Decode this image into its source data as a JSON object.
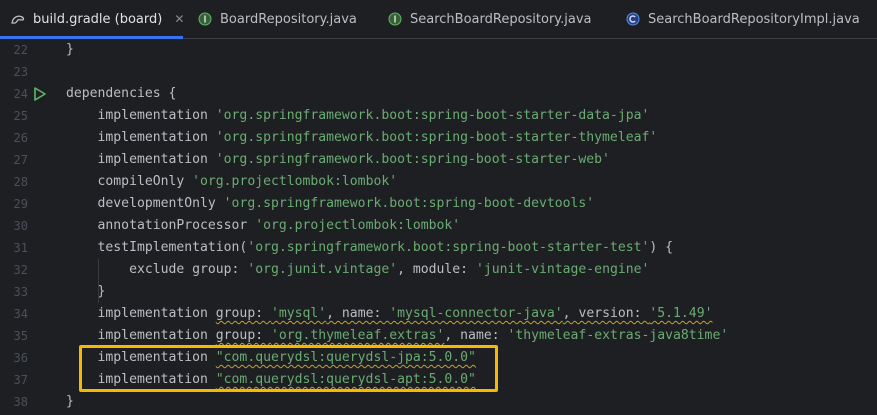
{
  "tabs": [
    {
      "label": "build.gradle (board)",
      "icon": "gradle-icon",
      "active": true
    },
    {
      "label": "BoardRepository.java",
      "icon": "interface-icon",
      "active": false
    },
    {
      "label": "SearchBoardRepository.java",
      "icon": "interface-icon",
      "active": false
    },
    {
      "label": "SearchBoardRepositoryImpl.java",
      "icon": "class-icon",
      "active": false
    }
  ],
  "colors": {
    "background": "#1e1f22",
    "text": "#bcbec4",
    "string": "#6aab73",
    "line_number": "#4b5059",
    "active_tab_underline": "#3574f0",
    "highlight_box": "#f7b800",
    "run_icon": "#5fb865"
  },
  "lines": [
    {
      "num": "22",
      "parts": [
        {
          "t": "}",
          "c": "plain"
        }
      ]
    },
    {
      "num": "23",
      "parts": []
    },
    {
      "num": "24",
      "parts": [
        {
          "t": "dependencies {",
          "c": "plain"
        }
      ]
    },
    {
      "num": "25",
      "parts": [
        {
          "t": "    implementation ",
          "c": "plain"
        },
        {
          "t": "'org.springframework.boot:spring-boot-starter-data-jpa'",
          "c": "str"
        }
      ]
    },
    {
      "num": "26",
      "parts": [
        {
          "t": "    implementation ",
          "c": "plain"
        },
        {
          "t": "'org.springframework.boot:spring-boot-starter-thymeleaf'",
          "c": "str"
        }
      ]
    },
    {
      "num": "27",
      "parts": [
        {
          "t": "    implementation ",
          "c": "plain"
        },
        {
          "t": "'org.springframework.boot:spring-boot-starter-web'",
          "c": "str"
        }
      ]
    },
    {
      "num": "28",
      "parts": [
        {
          "t": "    compileOnly ",
          "c": "plain"
        },
        {
          "t": "'org.projectlombok:lombok'",
          "c": "str"
        }
      ]
    },
    {
      "num": "29",
      "parts": [
        {
          "t": "    developmentOnly ",
          "c": "plain"
        },
        {
          "t": "'org.springframework.boot:spring-boot-devtools'",
          "c": "str"
        }
      ]
    },
    {
      "num": "30",
      "parts": [
        {
          "t": "    annotationProcessor ",
          "c": "plain"
        },
        {
          "t": "'org.projectlombok:lombok'",
          "c": "str"
        }
      ]
    },
    {
      "num": "31",
      "parts": [
        {
          "t": "    testImplementation(",
          "c": "plain"
        },
        {
          "t": "'org.springframework.boot:spring-boot-starter-test'",
          "c": "str"
        },
        {
          "t": ") {",
          "c": "plain"
        }
      ]
    },
    {
      "num": "32",
      "parts": [
        {
          "t": "        exclude group: ",
          "c": "plain"
        },
        {
          "t": "'org.junit.vintage'",
          "c": "str"
        },
        {
          "t": ", module: ",
          "c": "plain"
        },
        {
          "t": "'junit-vintage-engine'",
          "c": "str"
        }
      ]
    },
    {
      "num": "33",
      "parts": [
        {
          "t": "    }",
          "c": "plain"
        }
      ]
    },
    {
      "num": "34",
      "parts": [
        {
          "t": "    implementation ",
          "c": "plain"
        },
        {
          "t": "group: ",
          "c": "plain warn"
        },
        {
          "t": "'mysql'",
          "c": "str warn"
        },
        {
          "t": ", name: ",
          "c": "plain warn"
        },
        {
          "t": "'mysql-connector-java'",
          "c": "str warn"
        },
        {
          "t": ", version: ",
          "c": "plain warn"
        },
        {
          "t": "'5.1.49'",
          "c": "str warn"
        }
      ]
    },
    {
      "num": "35",
      "parts": [
        {
          "t": "    implementation ",
          "c": "plain"
        },
        {
          "t": "group: ",
          "c": "plain warn"
        },
        {
          "t": "'org.thymeleaf.extras'",
          "c": "str warn"
        },
        {
          "t": ", name: ",
          "c": "plain"
        },
        {
          "t": "'thymeleaf-extras-java8time'",
          "c": "str"
        }
      ]
    },
    {
      "num": "36",
      "parts": [
        {
          "t": "    implementation ",
          "c": "plain"
        },
        {
          "t": "\"com.querydsl:querydsl-jpa:5.0.0\"",
          "c": "str warn"
        }
      ]
    },
    {
      "num": "37",
      "parts": [
        {
          "t": "    implementation ",
          "c": "plain"
        },
        {
          "t": "\"com.querydsl:querydsl-apt:5.0.0\"",
          "c": "str warn"
        }
      ]
    },
    {
      "num": "38",
      "parts": [
        {
          "t": "}",
          "c": "plain"
        }
      ]
    }
  ]
}
